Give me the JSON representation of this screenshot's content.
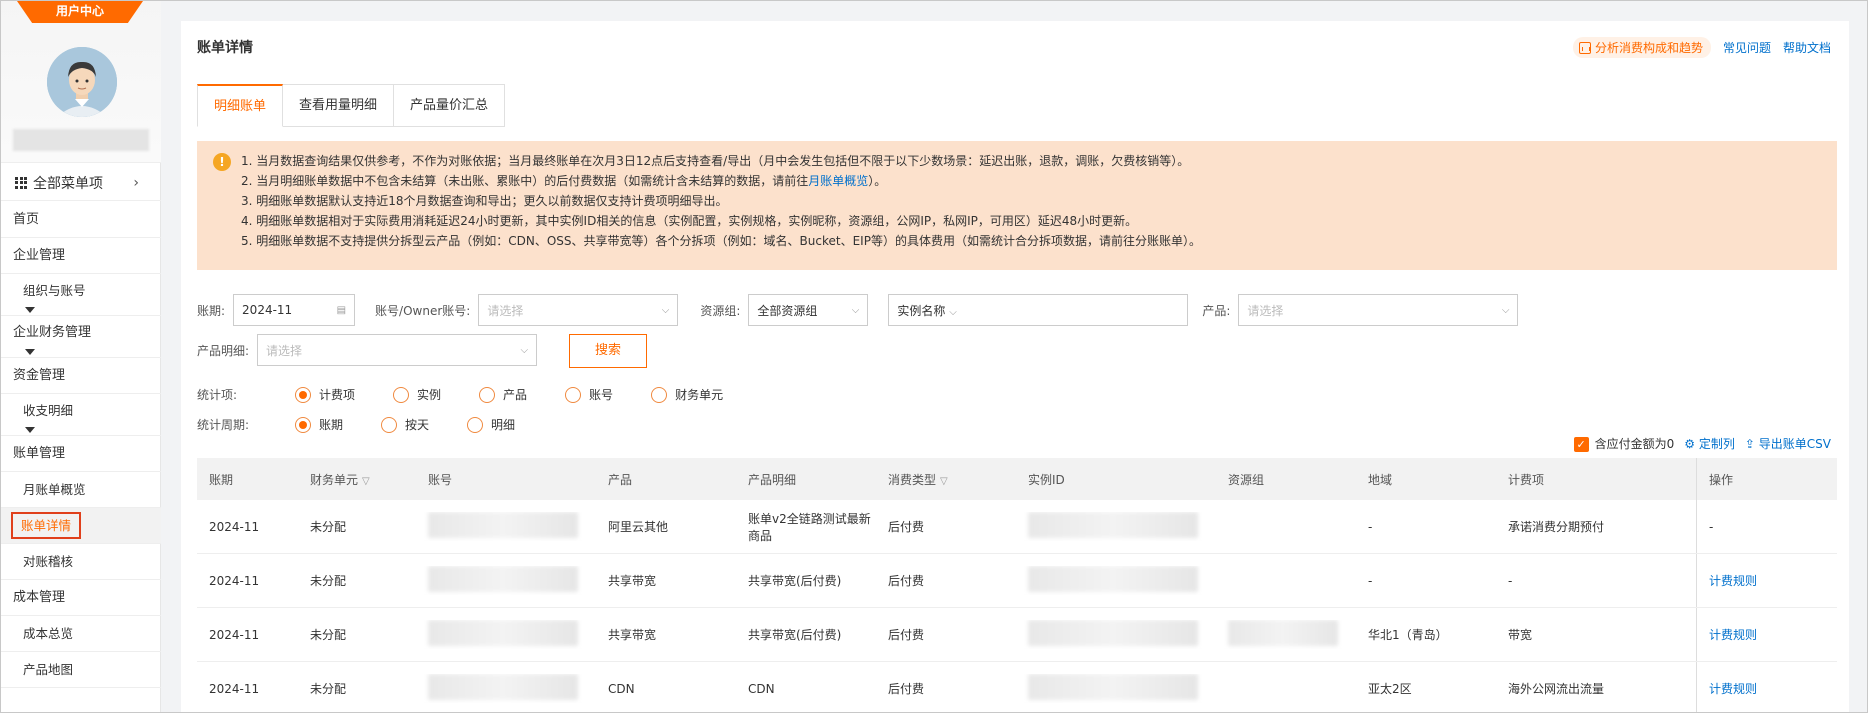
{
  "sidebar": {
    "banner": "用户中心",
    "all_menu": "全部菜单项",
    "items": [
      {
        "label": "首页",
        "kind": "section"
      },
      {
        "label": "企业管理",
        "kind": "section"
      },
      {
        "label": "组织与账号",
        "kind": "sub",
        "caret": true
      },
      {
        "label": "企业财务管理",
        "kind": "section",
        "caret": true
      },
      {
        "label": "资金管理",
        "kind": "section"
      },
      {
        "label": "收支明细",
        "kind": "sub",
        "caret": true
      },
      {
        "label": "账单管理",
        "kind": "section"
      },
      {
        "label": "月账单概览",
        "kind": "sub"
      },
      {
        "label": "账单详情",
        "kind": "sub",
        "active": true
      },
      {
        "label": "对账稽核",
        "kind": "sub"
      },
      {
        "label": "成本管理",
        "kind": "section"
      },
      {
        "label": "成本总览",
        "kind": "sub"
      },
      {
        "label": "产品地图",
        "kind": "sub"
      }
    ]
  },
  "header": {
    "title": "账单详情",
    "analyze": "分析消费构成和趋势",
    "faq": "常见问题",
    "help": "帮助文档"
  },
  "tabs": [
    "明细账单",
    "查看用量明细",
    "产品量价汇总"
  ],
  "notice": {
    "lines": [
      "1. 当月数据查询结果仅供参考，不作为对账依据；当月最终账单在次月3日12点后支持查看/导出（月中会发生包括但不限于以下少数场景：延迟出账，退款，调账，欠费核销等）。",
      "2. 当月明细账单数据中不包含未结算（未出账、累账中）的后付费数据（如需统计含未结算的数据，请前往",
      "3. 明细账单数据默认支持近18个月数据查询和导出；更久以前数据仅支持计费项明细导出。",
      "4. 明细账单数据相对于实际费用消耗延迟24小时更新，其中实例ID相关的信息（实例配置，实例规格，实例昵称，资源组，公网IP，私网IP，可用区）延迟48小时更新。",
      "5. 明细账单数据不支持提供分拆型云产品（例如：CDN、OSS、共享带宽等）各个分拆项（例如：域名、Bucket、EIP等）的具体费用（如需统计合分拆项数据，请前往分账账单）。"
    ],
    "line2_link": "月账单概览",
    "line2_tail": "）。"
  },
  "filters": {
    "period_label": "账期:",
    "period_value": "2024-11",
    "account_label": "账号/Owner账号:",
    "account_ph": "请选择",
    "rg_label": "资源组:",
    "rg_value": "全部资源组",
    "instance_value": "实例名称",
    "product_label": "产品:",
    "product_ph": "请选择",
    "detail_label": "产品明细:",
    "detail_ph": "请选择",
    "search": "搜索"
  },
  "stat_items": {
    "label": "统计项:",
    "options": [
      "计费项",
      "实例",
      "产品",
      "账号",
      "财务单元"
    ],
    "selected": 0
  },
  "stat_period": {
    "label": "统计周期:",
    "options": [
      "账期",
      "按天",
      "明细"
    ],
    "selected": 0
  },
  "actions": {
    "zero_label": "含应付金额为0",
    "customize": "定制列",
    "export": "导出账单CSV"
  },
  "table": {
    "headers": [
      "账期",
      "财务单元",
      "账号",
      "产品",
      "产品明细",
      "消费类型",
      "实例ID",
      "资源组",
      "地域",
      "计费项",
      "操作"
    ],
    "rows": [
      [
        "2024-11",
        "未分配",
        "",
        "阿里云其他",
        "账单v2全链路测试最新商品",
        "后付费",
        "",
        "",
        "-",
        "承诺消费分期预付",
        "-"
      ],
      [
        "2024-11",
        "未分配",
        "",
        "共享带宽",
        "共享带宽(后付费)",
        "后付费",
        "",
        "",
        "-",
        "-",
        "计费规则"
      ],
      [
        "2024-11",
        "未分配",
        "",
        "共享带宽",
        "共享带宽(后付费)",
        "后付费",
        "",
        "",
        "华北1（青岛）",
        "带宽",
        "计费规则"
      ],
      [
        "2024-11",
        "未分配",
        "",
        "CDN",
        "CDN",
        "后付费",
        "",
        "",
        "亚太2区",
        "海外公网流出流量",
        "计费规则"
      ]
    ]
  }
}
